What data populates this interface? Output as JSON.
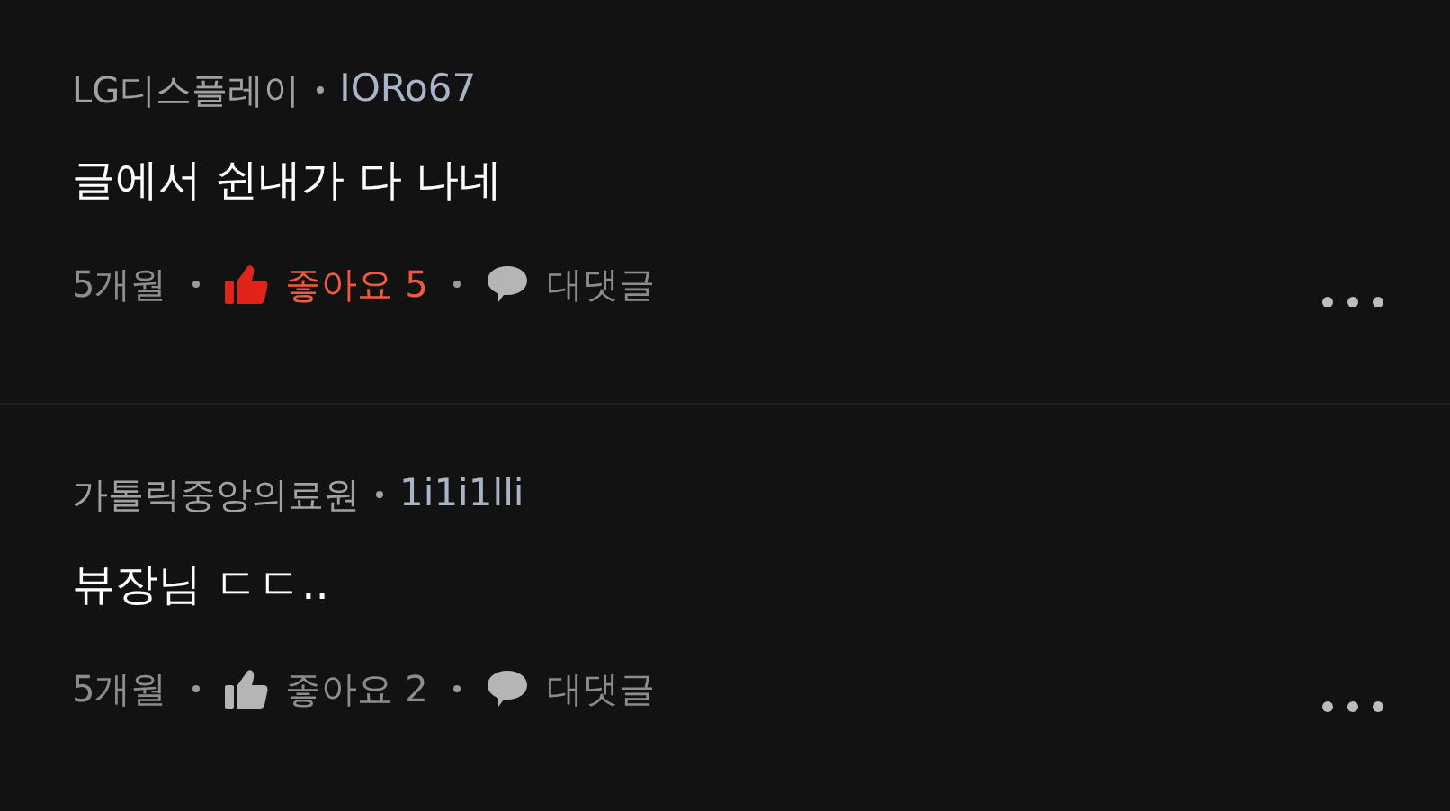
{
  "comments": [
    {
      "author": "LG디스플레이",
      "handle": "IORo67",
      "text": "글에서 쉰내가 다 나네",
      "time": "5개월",
      "liked": true,
      "likes": "좋아요 5",
      "reply": "대댓글"
    },
    {
      "author": "가톨릭중앙의료원",
      "handle": "1i1i1lli",
      "text": "뷰장님 ㄷㄷ..",
      "time": "5개월",
      "liked": false,
      "likes": "좋아요 2",
      "reply": "대댓글"
    }
  ]
}
